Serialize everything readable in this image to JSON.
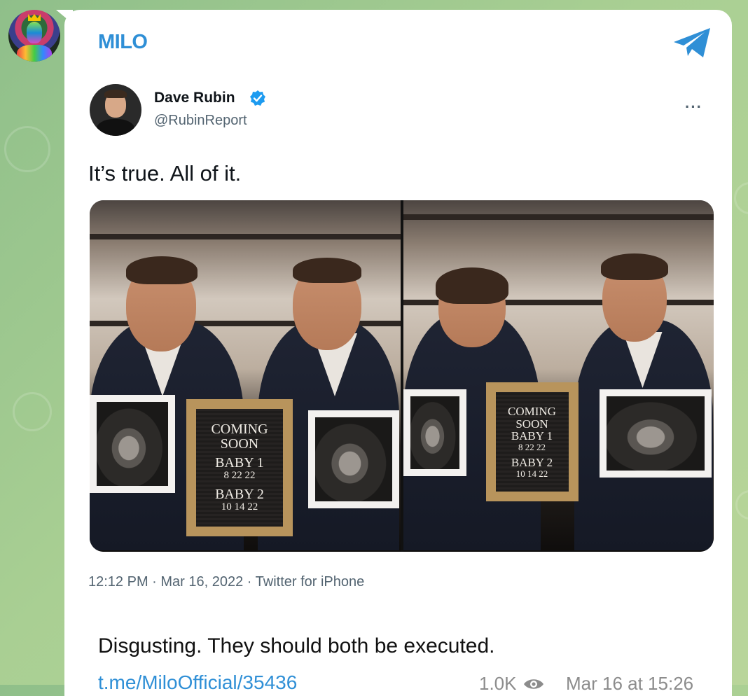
{
  "channel": {
    "name": "MILO",
    "avatar_icon": "channel-avatar",
    "share_icon": "paper-plane-icon",
    "accent_color": "#2f8fd6"
  },
  "tweet": {
    "author_name": "Dave Rubin",
    "author_handle": "@RubinReport",
    "verified_icon": "verified-badge-icon",
    "more_icon": "more-dots-icon",
    "more_label": "···",
    "text": "It’s true. All of it.",
    "meta": "12:12 PM · Mar 16, 2022 · Twitter for iPhone",
    "photos": [
      {
        "board": {
          "line1": "COMING",
          "line2": "SOON",
          "line3": "BABY 1",
          "line4": "8 22 22",
          "line5": "BABY 2",
          "line6": "10 14 22"
        }
      },
      {
        "board": {
          "line1": "COMING",
          "line2": "SOON",
          "line3": "BABY 1",
          "line4": "8 22 22",
          "line5": "BABY 2",
          "line6": "10 14 22"
        }
      }
    ]
  },
  "post": {
    "text": "Disgusting. They should both be executed.",
    "link": "t.me/MiloOfficial/35436",
    "views": "1.0K",
    "views_icon": "eye-icon",
    "time": "Mar 16 at 15:26"
  }
}
